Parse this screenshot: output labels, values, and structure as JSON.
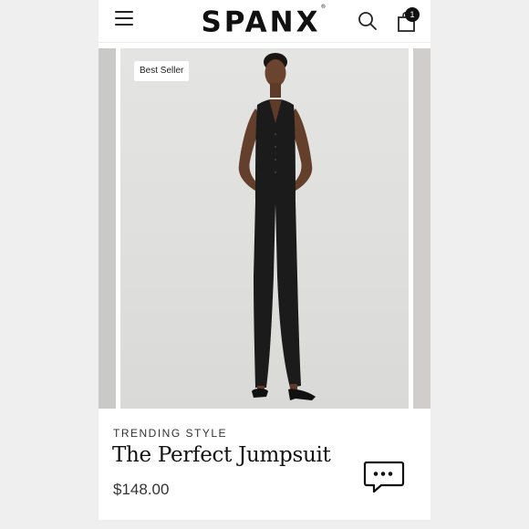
{
  "header": {
    "logo_text": "SPANX",
    "logo_mark": "®",
    "menu_icon": "hamburger-menu-icon",
    "search_icon": "search-icon",
    "bag_icon": "shopping-bag-icon",
    "bag_count": "1"
  },
  "product": {
    "badge": "Best Seller",
    "eyebrow": "TRENDING STYLE",
    "name": "The Perfect Jumpsuit",
    "price": "$148.00"
  },
  "chat": {
    "icon": "chat-bubble-icon"
  },
  "colors": {
    "page_bg": "#efefef",
    "card_bg": "#ffffff",
    "text": "#111111",
    "garment": "#1b1b1c",
    "photo_bg": "#e0e0de"
  }
}
